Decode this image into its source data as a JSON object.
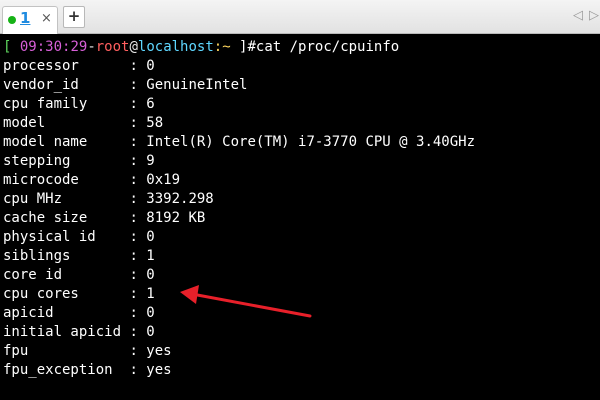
{
  "tabbar": {
    "tab_label": "1",
    "tab_close": "×",
    "new_tab": "+",
    "scroll_left": "◁",
    "scroll_right": "▷"
  },
  "prompt": {
    "open_bracket": "[",
    "time": "09:30:29",
    "dash": "-",
    "user": "root",
    "at": "@",
    "host": "localhost",
    "path": ":~",
    "rest": " ]#cat /proc/cpuinfo"
  },
  "cpuinfo": [
    {
      "key": "processor      ",
      "value": "0"
    },
    {
      "key": "vendor_id      ",
      "value": "GenuineIntel"
    },
    {
      "key": "cpu family     ",
      "value": "6"
    },
    {
      "key": "model          ",
      "value": "58"
    },
    {
      "key": "model name     ",
      "value": "Intel(R) Core(TM) i7-3770 CPU @ 3.40GHz"
    },
    {
      "key": "stepping       ",
      "value": "9"
    },
    {
      "key": "microcode      ",
      "value": "0x19"
    },
    {
      "key": "cpu MHz        ",
      "value": "3392.298"
    },
    {
      "key": "cache size     ",
      "value": "8192 KB"
    },
    {
      "key": "physical id    ",
      "value": "0"
    },
    {
      "key": "siblings       ",
      "value": "1"
    },
    {
      "key": "core id        ",
      "value": "0"
    },
    {
      "key": "cpu cores      ",
      "value": "1"
    },
    {
      "key": "apicid         ",
      "value": "0"
    },
    {
      "key": "initial apicid ",
      "value": "0"
    },
    {
      "key": "fpu            ",
      "value": "yes"
    },
    {
      "key": "fpu_exception  ",
      "value": "yes"
    }
  ],
  "annotation_color": "#e8202a"
}
